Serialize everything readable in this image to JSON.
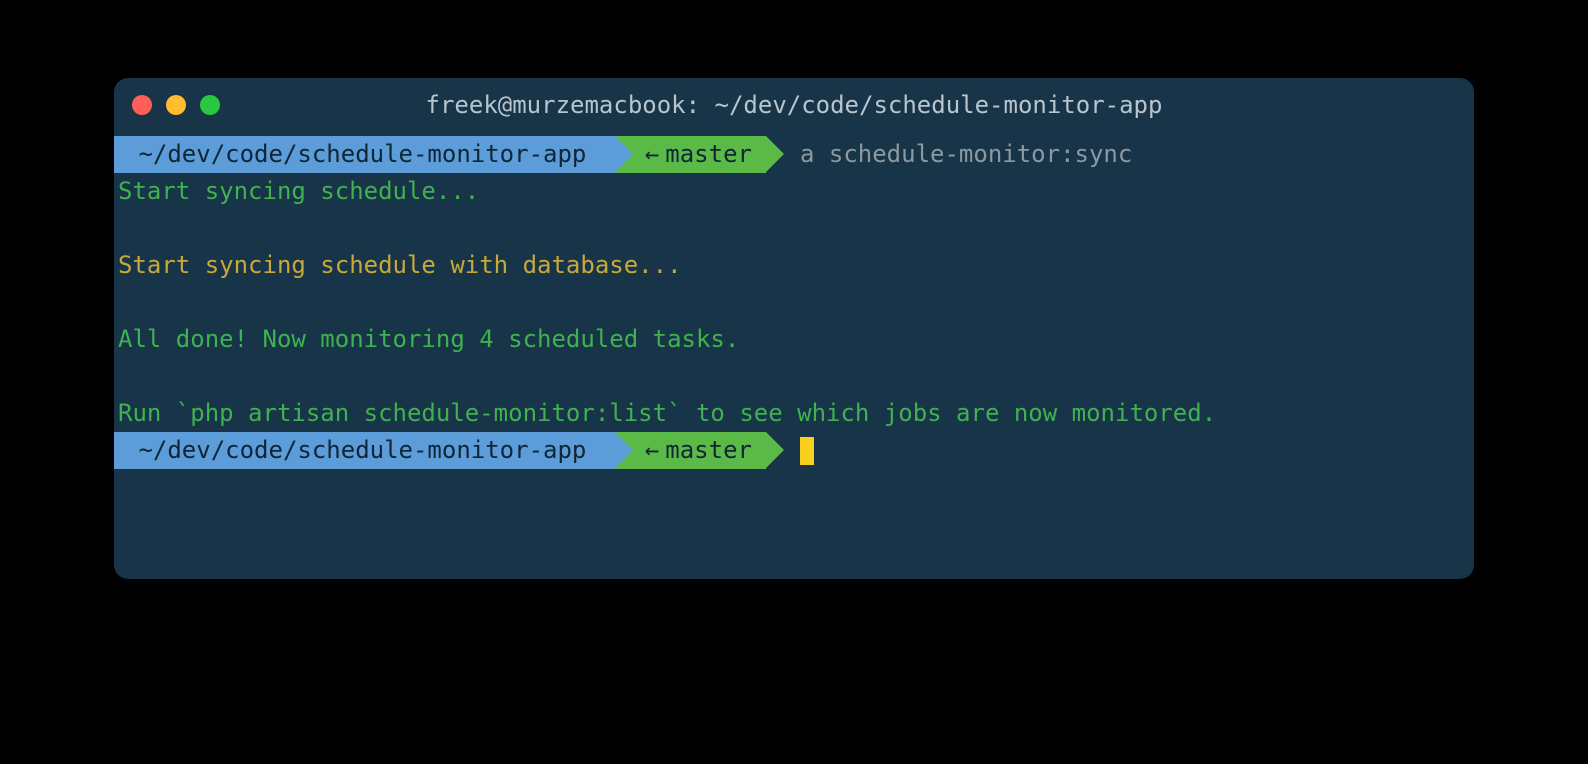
{
  "window": {
    "title": "freek@murzemacbook: ~/dev/code/schedule-monitor-app"
  },
  "colors": {
    "bg": "#173448",
    "path_segment": "#5c9cd9",
    "branch_segment": "#5bba47",
    "green_text": "#3fb24f",
    "yellow_text": "#c7a93a",
    "dim_text": "#8d99a1",
    "cursor": "#f7d11e"
  },
  "prompt1": {
    "path": " ~/dev/code/schedule-monitor-app ",
    "branch_arrow": "←",
    "branch": "master",
    "command": "a schedule-monitor:sync"
  },
  "output": {
    "line1": "Start syncing schedule...",
    "line2": "Start syncing schedule with database...",
    "line3": "All done! Now monitoring 4 scheduled tasks.",
    "line4": "Run `php artisan schedule-monitor:list` to see which jobs are now monitored."
  },
  "prompt2": {
    "path": " ~/dev/code/schedule-monitor-app ",
    "branch_arrow": "←",
    "branch": "master"
  }
}
